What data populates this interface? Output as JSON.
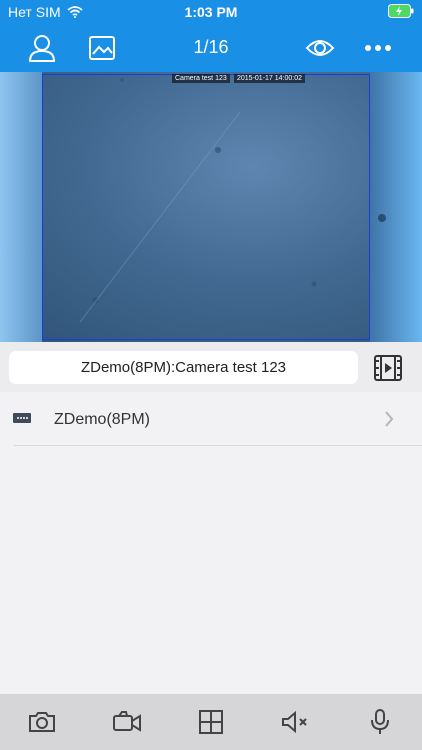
{
  "status_bar": {
    "carrier": "Нет SIM",
    "time": "1:03 PM"
  },
  "nav": {
    "title": "1/16",
    "icons": [
      "person-icon",
      "image-icon",
      "eye-icon",
      "more-icon"
    ]
  },
  "video": {
    "osd_camera_name": "Camera test 123",
    "osd_timestamp": "2015-01-17 14:00:02"
  },
  "camera_bar": {
    "label": "ZDemo(8PM):Camera test 123"
  },
  "device_list": [
    {
      "label": "ZDemo(8PM)"
    }
  ],
  "toolbar": {
    "icons": [
      "camera-icon",
      "video-record-icon",
      "grid-icon",
      "mute-icon",
      "microphone-icon"
    ]
  },
  "colors": {
    "accent": "#1a8fe6",
    "toolbar_bg": "#d6d6d8",
    "background": "#f2f2f4"
  }
}
